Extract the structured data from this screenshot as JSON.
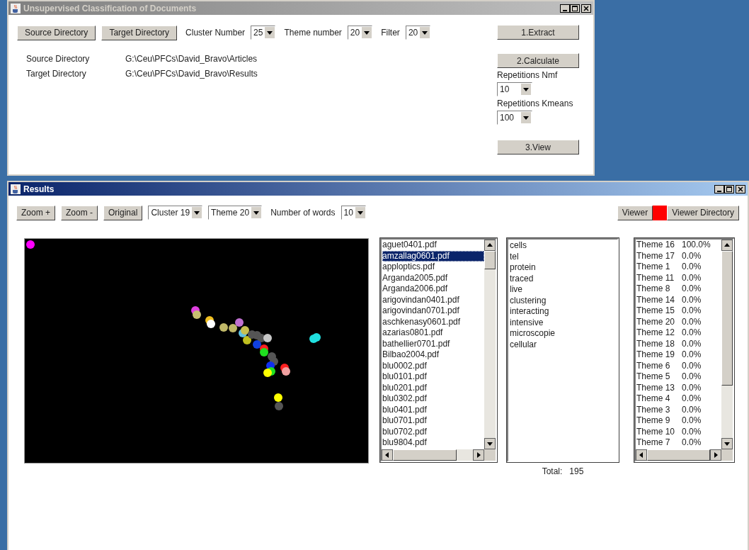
{
  "main_window": {
    "title": "Unsupervised Classification of Documents",
    "toolbar": [
      {
        "kind": "button",
        "label": "Source Directory"
      },
      {
        "kind": "button",
        "label": "Target Directory"
      },
      {
        "kind": "combo",
        "label": "Cluster Number",
        "value": "25"
      },
      {
        "kind": "combo",
        "label": "Theme number",
        "value": "20"
      },
      {
        "kind": "combo",
        "label": "Filter",
        "value": "20"
      }
    ],
    "directories": [
      {
        "label": "Source Directory",
        "path": "G:\\Ceu\\PFCs\\David_Bravo\\Articles"
      },
      {
        "label": "Target Directory",
        "path": "G:\\Ceu\\PFCs\\David_Bravo\\Results"
      }
    ],
    "actions": [
      {
        "kind": "button",
        "label": "1.Extract"
      },
      {
        "kind": "button",
        "label": "2.Calculate"
      },
      {
        "kind": "combo",
        "label": "Repetitions Nmf",
        "value": "10"
      },
      {
        "kind": "combo",
        "label": "Repetitions Kmeans",
        "value": "100"
      },
      {
        "kind": "button",
        "label": "3.View"
      }
    ]
  },
  "results_window": {
    "title": "Results",
    "toolbar": [
      {
        "kind": "button",
        "label": "Zoom +"
      },
      {
        "kind": "button",
        "label": "Zoom -"
      },
      {
        "kind": "button",
        "label": "Original"
      },
      {
        "kind": "combo",
        "value": "Cluster 19"
      },
      {
        "kind": "combo",
        "value": "Theme 20"
      },
      {
        "kind": "combo",
        "label": "Number of words",
        "value": "10"
      }
    ],
    "viewer": {
      "label": "Viewer",
      "color": "#ff0000",
      "directory_button": "Viewer Directory"
    },
    "files": [
      {
        "name": "aguet0401.pdf",
        "selected": false
      },
      {
        "name": "amzallag0601.pdf",
        "selected": true
      },
      {
        "name": "apploptics.pdf",
        "selected": false
      },
      {
        "name": "Arganda2005.pdf",
        "selected": false
      },
      {
        "name": "Arganda2006.pdf",
        "selected": false
      },
      {
        "name": "arigovindan0401.pdf",
        "selected": false
      },
      {
        "name": "arigovindan0701.pdf",
        "selected": false
      },
      {
        "name": "aschkenasy0601.pdf",
        "selected": false
      },
      {
        "name": "azarias0801.pdf",
        "selected": false
      },
      {
        "name": "bathellier0701.pdf",
        "selected": false
      },
      {
        "name": "Bilbao2004.pdf",
        "selected": false
      },
      {
        "name": "blu0002.pdf",
        "selected": false
      },
      {
        "name": "blu0101.pdf",
        "selected": false
      },
      {
        "name": "blu0201.pdf",
        "selected": false
      },
      {
        "name": "blu0302.pdf",
        "selected": false
      },
      {
        "name": "blu0401.pdf",
        "selected": false
      },
      {
        "name": "blu0701.pdf",
        "selected": false
      },
      {
        "name": "blu0702.pdf",
        "selected": false
      },
      {
        "name": "blu9804.pdf",
        "selected": false
      }
    ],
    "words": [
      "cells",
      "tel",
      "protein",
      "traced",
      "live",
      "clustering",
      "interacting",
      "intensive",
      "microscopie",
      "cellular"
    ],
    "themes": [
      {
        "name": "Theme 16",
        "share": "100.0%"
      },
      {
        "name": "Theme 17",
        "share": "0.0%"
      },
      {
        "name": "Theme 1",
        "share": "0.0%"
      },
      {
        "name": "Theme 11",
        "share": "0.0%"
      },
      {
        "name": "Theme 8",
        "share": "0.0%"
      },
      {
        "name": "Theme 14",
        "share": "0.0%"
      },
      {
        "name": "Theme 15",
        "share": "0.0%"
      },
      {
        "name": "Theme 20",
        "share": "0.0%"
      },
      {
        "name": "Theme 12",
        "share": "0.0%"
      },
      {
        "name": "Theme 18",
        "share": "0.0%"
      },
      {
        "name": "Theme 19",
        "share": "0.0%"
      },
      {
        "name": "Theme 6",
        "share": "0.0%"
      },
      {
        "name": "Theme 5",
        "share": "0.0%"
      },
      {
        "name": "Theme 13",
        "share": "0.0%"
      },
      {
        "name": "Theme 4",
        "share": "0.0%"
      },
      {
        "name": "Theme 3",
        "share": "0.0%"
      },
      {
        "name": "Theme 9",
        "share": "0.0%"
      },
      {
        "name": "Theme 10",
        "share": "0.0%"
      },
      {
        "name": "Theme 7",
        "share": "0.0%"
      }
    ],
    "total": {
      "label": "Total:",
      "value": "195"
    }
  }
}
